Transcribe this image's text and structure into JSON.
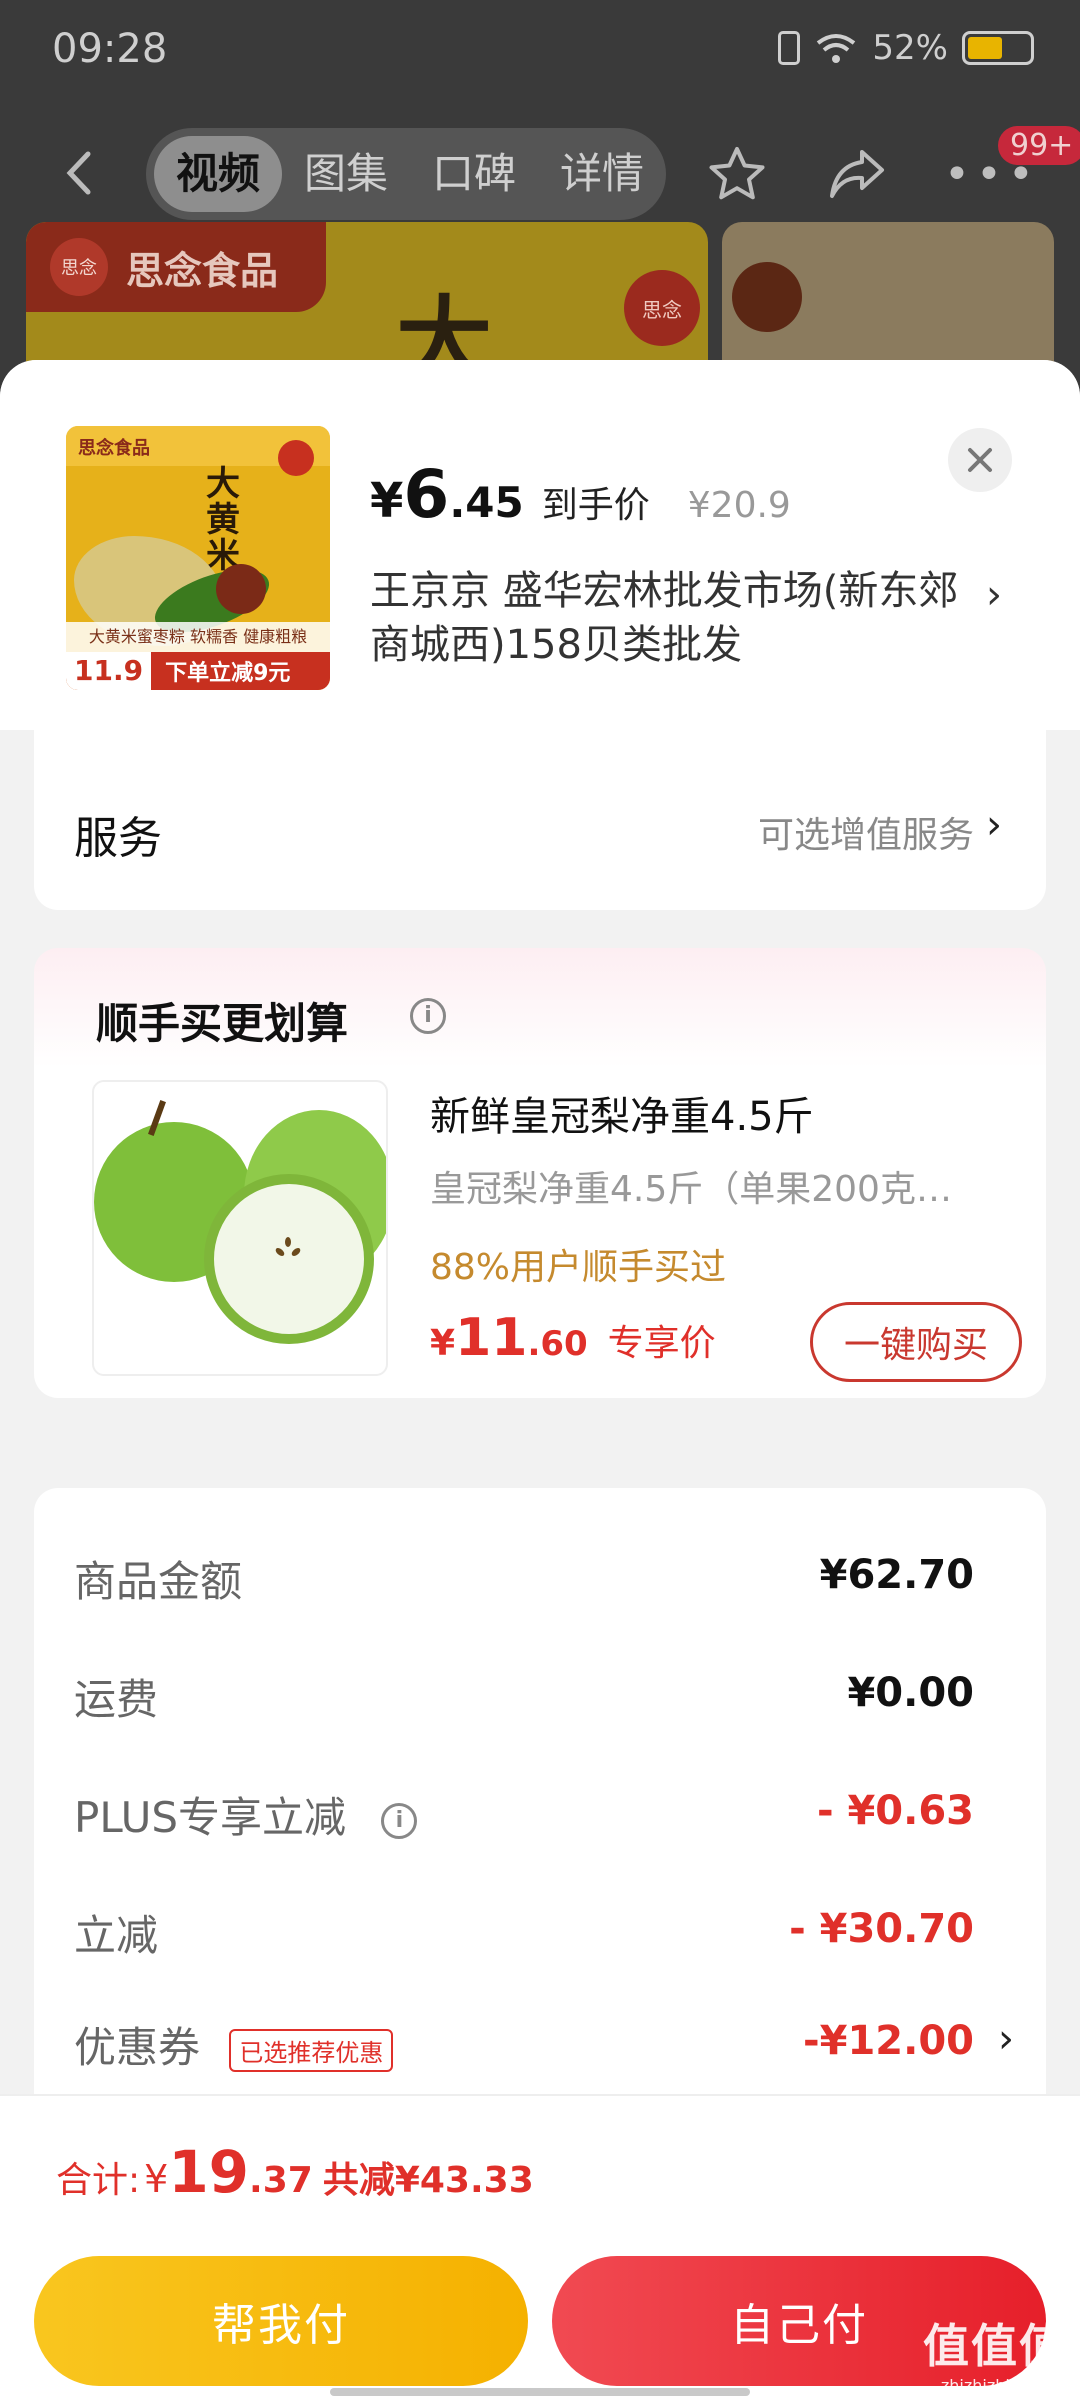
{
  "status_bar": {
    "time": "09:28",
    "battery": "52%",
    "battery_level": 0.52
  },
  "nav": {
    "tabs": [
      {
        "label": "视频",
        "active": true
      },
      {
        "label": "图集",
        "active": false
      },
      {
        "label": "口碑",
        "active": false
      },
      {
        "label": "详情",
        "active": false
      }
    ],
    "badge": "99+"
  },
  "banner": {
    "brand": "思念食品",
    "logo_text": "思念",
    "big_char": "大"
  },
  "product": {
    "image": {
      "brand": "思念食品",
      "title": "大黄米",
      "desc": "大黄米蜜枣粽 软糯香 健康粗粮",
      "price": "11.9",
      "cut": "下单立减9元"
    },
    "price_symbol": "¥",
    "price_int": "6",
    "price_dec": ".45",
    "price_label": "到手价",
    "original_price": "¥20.9",
    "address": "王京京  盛华宏林批发市场(新东郊商城西)158贝类批发"
  },
  "service": {
    "label": "服务",
    "value": "可选增值服务"
  },
  "bundle": {
    "title": "顺手买更划算",
    "name": "新鲜皇冠梨净重4.5斤",
    "desc": "皇冠梨净重4.5斤（单果200克…",
    "percent": "88%用户顺手买过",
    "price_symbol": "¥",
    "price_int": "11",
    "price_dec": ".60",
    "price_label": "专享价",
    "buy_label": "一键购买"
  },
  "summary": {
    "rows": [
      {
        "label": "商品金额",
        "value": "¥62.70"
      },
      {
        "label": "运费",
        "value": "¥0.00"
      },
      {
        "label": "PLUS专享立减",
        "value": "- ¥0.63"
      },
      {
        "label": "立减",
        "value": "- ¥30.70"
      },
      {
        "label": "优惠券",
        "value": "-¥12.00",
        "tag": "已选推荐优惠"
      }
    ]
  },
  "footer": {
    "total_label": "合计:",
    "total_symbol": "¥",
    "total_int": "19",
    "total_dec": ".37",
    "saved": "共减¥43.33",
    "pay_friend": "帮我付",
    "pay_self": "自己付"
  },
  "watermark": {
    "big": "值值值",
    "small": "zhizhizhi.com"
  },
  "colors": {
    "accent_red": "#e0302a",
    "accent_gold": "#c58a2e",
    "pay_yellow": "#f5b100",
    "pay_red": "#e61f2a"
  }
}
